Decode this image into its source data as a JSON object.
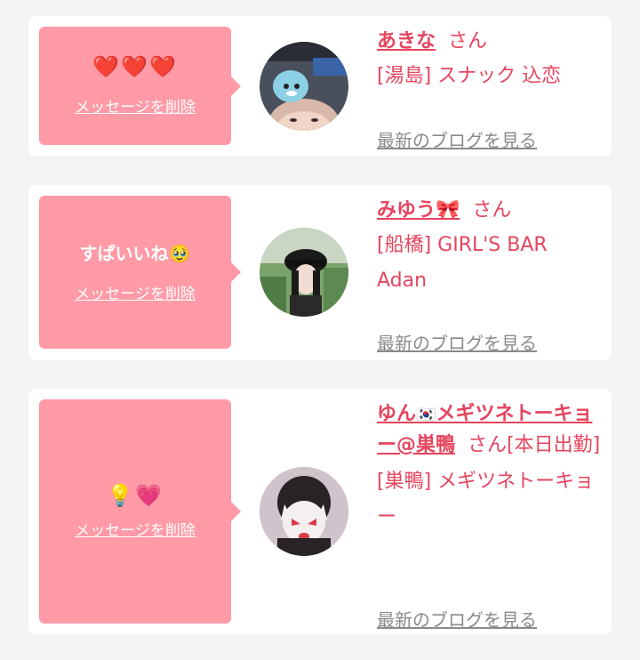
{
  "cards": [
    {
      "message": "❤️❤️❤️",
      "delete_label": "メッセージを削除",
      "name": "あきな",
      "honorific": "さん",
      "shop": "[湯島] スナック 込恋",
      "blog_link": "最新のブログを見る"
    },
    {
      "message": "すぱいいね🥹",
      "delete_label": "メッセージを削除",
      "name": "みゆう🎀",
      "honorific": "さん",
      "shop": "[船橋] GIRL'S BAR Adan",
      "blog_link": "最新のブログを見る"
    },
    {
      "message": "💡💗",
      "delete_label": "メッセージを削除",
      "name_part1": "ゆん",
      "name_flag": "🇰🇷",
      "name_part2": "メギツネトーキョー@巣鴨",
      "honorific": "さん[本日出勤]",
      "shop": "[巣鴨] メギツネトーキョー",
      "blog_link": "最新のブログを見る"
    }
  ],
  "colors": {
    "bubble": "#ff9aa6",
    "accent": "#e5455e",
    "link_gray": "#8a8a8a",
    "background": "#f3f3f3"
  }
}
